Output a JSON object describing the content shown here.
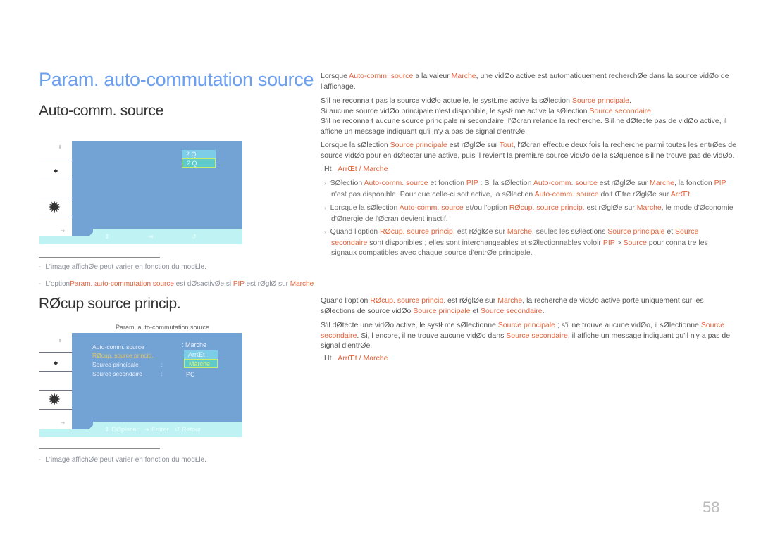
{
  "page": {
    "title": "Param. auto-commutation source",
    "page_number": "58",
    "accent_color": "#6b9ff0",
    "highlight_color": "#e2643c"
  },
  "section1": {
    "heading": "Auto-comm. source",
    "osd": {
      "options": [
        "2 Q",
        "2 Q"
      ],
      "bar_icons": [
        "move-icon",
        "enter-icon",
        "return-icon"
      ]
    },
    "notes": [
      {
        "text": "L'image affichØe peut varier en fonction du modŁle."
      },
      {
        "pre": "L'option",
        "hl1": "Param. auto-commutation source",
        "mid": " est dØsactivØe si ",
        "hl2": "PIP",
        "post": " est rØglØ sur ",
        "hl3": "Marche"
      }
    ]
  },
  "section2": {
    "heading": "RØcup source princip.",
    "osd": {
      "caption": "Param. auto-commutation source",
      "rows": [
        {
          "label": "Auto-comm. source",
          "sep": ":",
          "value": "Marche"
        },
        {
          "label": "RØcup. source princip.",
          "sep": "",
          "value": ""
        },
        {
          "label": "Source principale",
          "sep": ":",
          "value": ""
        },
        {
          "label": "Source secondaire",
          "sep": ":",
          "value": "PC"
        }
      ],
      "options": [
        "ArrŒt",
        "Marche"
      ],
      "bar": {
        "move": "DØplacer",
        "enter": "Entrer",
        "return": "Retour"
      }
    },
    "notes": [
      {
        "text": "L'image affichØe peut varier en fonction du modŁle."
      }
    ]
  },
  "right": {
    "p1": {
      "a": "Lorsque ",
      "b": "Auto-comm. source",
      "c": " a la valeur ",
      "d": "Marche",
      "e": ", une vidØo active est automatiquement recherchØe dans la source vidØo de",
      "f": "l'affichage."
    },
    "p2": {
      "l1a": "S'il ne reconna t pas la source vidØo actuelle, le systŁme active la sØlection ",
      "l1b": "Source principale",
      "l1c": ".",
      "l2a": "Si aucune source vidØo principale n'est disponible, le systŁme active la sØlection ",
      "l2b": "Source secondaire",
      "l2c": ".",
      "l3": "S'il ne reconna t aucune source principale ni secondaire, l'Øcran relance la recherche. S'il ne dØtecte pas de vidØo active, il",
      "l4": "affiche un message indiquant qu'il n'y a pas de signal d'entrØe."
    },
    "p3": {
      "a": "Lorsque la sØlection ",
      "b": "Source principale",
      "c": " est rØglØe sur ",
      "d": "Tout",
      "e": ", l'Øcran effectue deux fois la recherche parmi toutes les entrØes de",
      "f": "source vidØo pour en dØtecter une active, puis il revient   la premiŁre source vidØo de la sØquence s'il ne trouve pas de vidØo."
    },
    "opt1": {
      "prefix": "Ht",
      "a": "ArrŒt",
      "sep": " / ",
      "b": "Marche"
    },
    "bullets": [
      {
        "l1": [
          [
            "SØlection ",
            0
          ],
          [
            "Auto-comm. source",
            1
          ],
          [
            " et fonction ",
            0
          ],
          [
            "PIP",
            1
          ],
          [
            " : Si la sØlection ",
            0
          ],
          [
            "Auto-comm. source",
            1
          ],
          [
            " est rØglØe sur ",
            0
          ],
          [
            "Marche",
            1
          ],
          [
            ", la fonction ",
            0
          ],
          [
            "PIP",
            1
          ]
        ],
        "l2": [
          [
            "n'est pas disponible. Pour que celle-ci soit active, la sØlection ",
            0
          ],
          [
            "Auto-comm. source",
            1
          ],
          [
            " doit Œtre rØglØe sur ",
            0
          ],
          [
            "ArrŒt",
            1
          ],
          [
            ".",
            0
          ]
        ]
      },
      {
        "l1": [
          [
            "Lorsque la sØlection ",
            0
          ],
          [
            "Auto-comm. source",
            1
          ],
          [
            " et/ou l'option ",
            0
          ],
          [
            "RØcup. source princip.",
            1
          ],
          [
            " est rØglØe sur ",
            0
          ],
          [
            "Marche",
            1
          ],
          [
            ", le mode d'Øconomie",
            0
          ]
        ],
        "l2": [
          [
            "d'Ønergie de l'Øcran devient inactif.",
            0
          ]
        ]
      },
      {
        "l1": [
          [
            "Quand l'option ",
            0
          ],
          [
            "RØcup. source princip.",
            1
          ],
          [
            " est rØglØe sur ",
            0
          ],
          [
            "Marche",
            1
          ],
          [
            ", seules les sØlections ",
            0
          ],
          [
            "Source principale",
            1
          ],
          [
            " et ",
            0
          ],
          [
            "Source",
            1
          ]
        ],
        "l2": [
          [
            "secondaire",
            1
          ],
          [
            " sont disponibles ; elles sont interchangeables et sØlectionnables   voloir ",
            0
          ],
          [
            "PIP",
            1
          ],
          [
            " > ",
            0
          ],
          [
            "Source",
            1
          ],
          [
            " pour conna tre les",
            0
          ]
        ],
        "l3": [
          [
            "signaux compatibles avec chaque source d'entrØe principale.",
            0
          ]
        ]
      }
    ],
    "p4": {
      "a": "Quand l'option ",
      "b": "RØcup. source princip.",
      "c": " est rØglØe sur ",
      "d": "Marche",
      "e": ", la recherche de vidØo active porte uniquement sur les",
      "f": "sØlections de source vidØo ",
      "g": "Source principale",
      "h": " et ",
      "i": "Source secondaire",
      "j": "."
    },
    "p5": {
      "a": "S'il dØtecte une vidØo active, le systŁme sØlectionne ",
      "b": "Source principale",
      "c": " ; s'il ne trouve aucune vidØo, il sØlectionne ",
      "d": "Source",
      "e": "secondaire",
      "f": ". Si, l  encore, il ne trouve aucune vidØo dans ",
      "g": "Source secondaire",
      "h": ", il affiche un message indiquant qu'il n'y a pas de",
      "i": "signal d'entrØe."
    },
    "opt2": {
      "prefix": "Ht",
      "a": "ArrŒt",
      "sep": " / ",
      "b": "Marche"
    }
  }
}
